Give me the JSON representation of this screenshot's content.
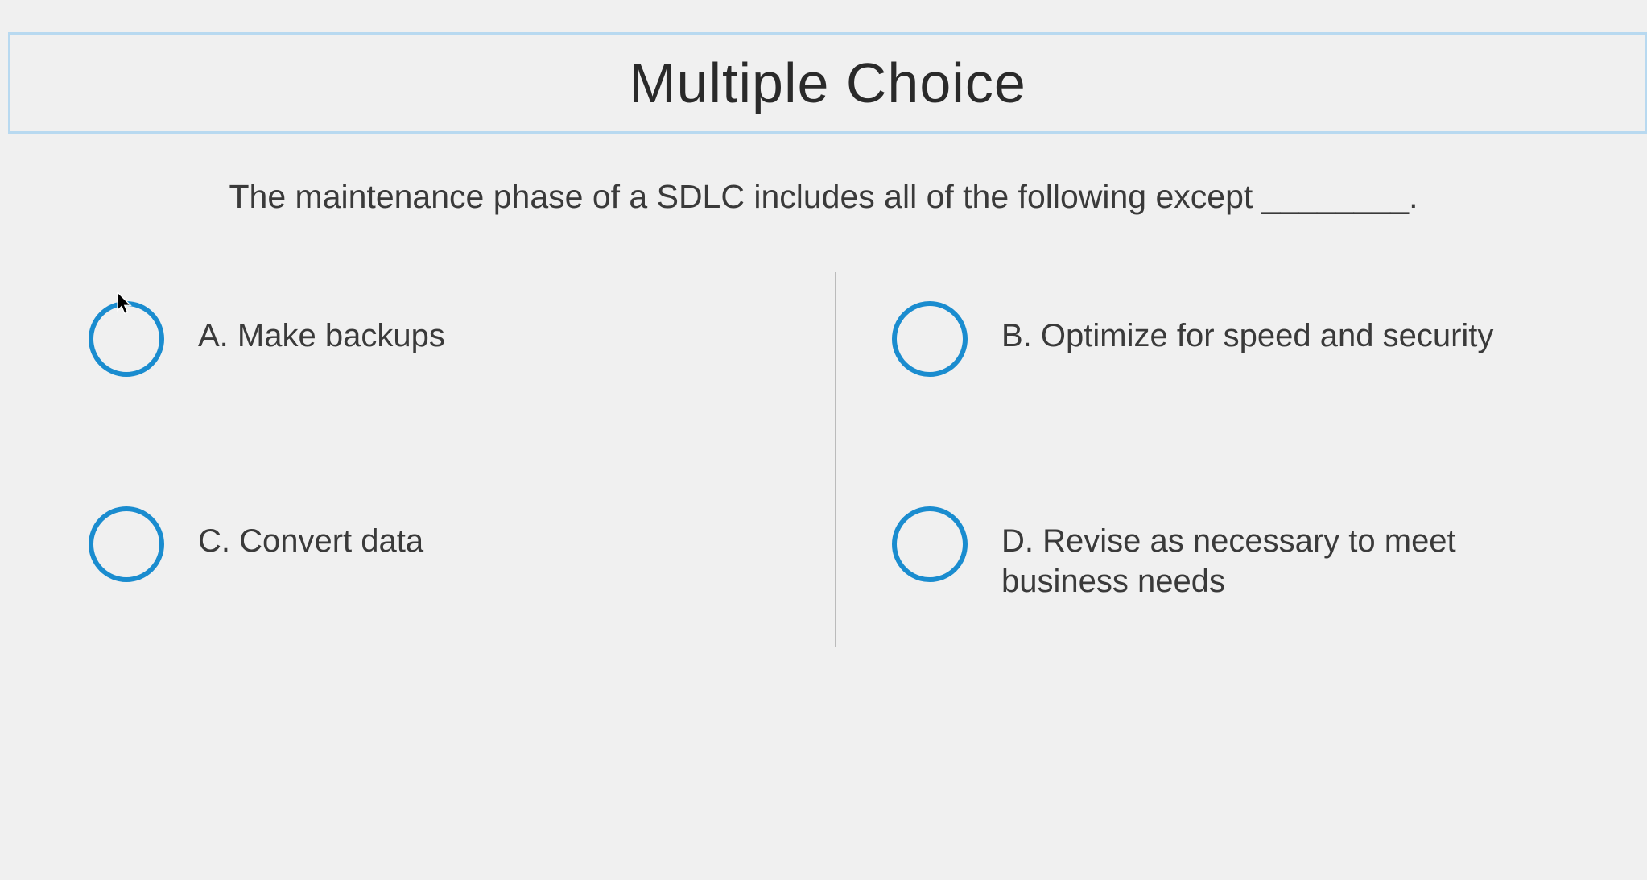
{
  "title": "Multiple Choice",
  "question": "The maintenance phase of a SDLC includes all of the following except ________.",
  "options": {
    "a": "A. Make backups",
    "b": "B. Optimize for speed and security",
    "c": "C. Convert data",
    "d": "D. Revise as necessary to meet business needs"
  }
}
